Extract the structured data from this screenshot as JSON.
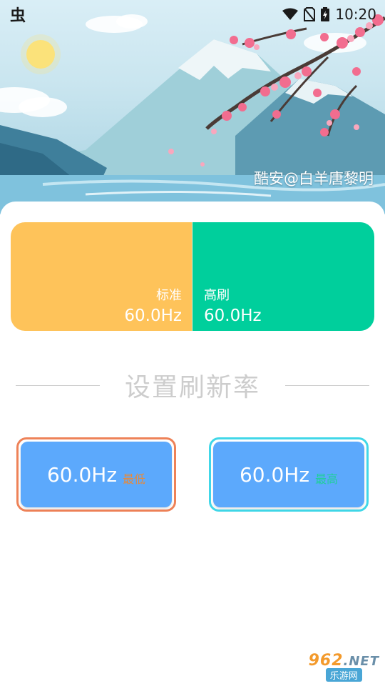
{
  "status_bar": {
    "app_icon_text": "虫",
    "time": "10:20",
    "icons": [
      "wifi-icon",
      "no-sim-icon",
      "battery-charging-icon"
    ]
  },
  "header": {
    "credit": "酷安@白羊唐黎明"
  },
  "mode_panel": {
    "standard": {
      "label": "标准",
      "value": "60.0Hz",
      "color": "#fec35a"
    },
    "high": {
      "label": "高刷",
      "value": "60.0Hz",
      "color": "#00cf9c"
    }
  },
  "section": {
    "title": "设置刷新率"
  },
  "rate_buttons": {
    "min": {
      "value": "60.0Hz",
      "tag": "最低",
      "border_color": "#ee8258"
    },
    "max": {
      "value": "60.0Hz",
      "tag": "最高",
      "border_color": "#40d7e8"
    }
  },
  "watermark": {
    "brand": "962",
    "suffix": ".NET",
    "subtitle": "乐游网"
  }
}
